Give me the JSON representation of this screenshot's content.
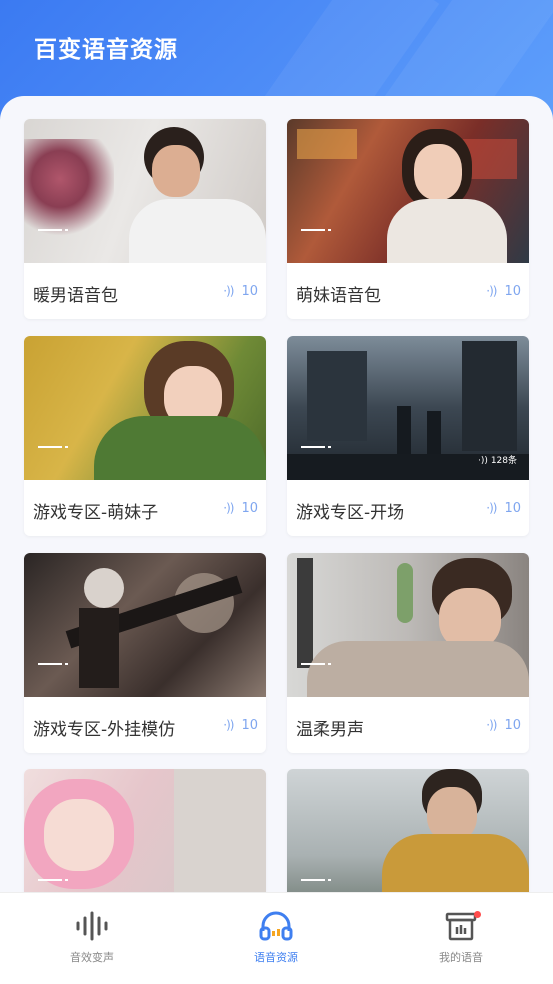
{
  "header": {
    "title": "百变语音资源"
  },
  "cards": [
    {
      "label": "暖男语音包",
      "count": "10"
    },
    {
      "label": "萌妹语音包",
      "count": "10"
    },
    {
      "label": "游戏专区-萌妹子",
      "count": "10"
    },
    {
      "label": "游戏专区-开场",
      "count": "10",
      "badge": "128条"
    },
    {
      "label": "游戏专区-外挂模仿",
      "count": "10"
    },
    {
      "label": "温柔男声",
      "count": "10"
    },
    {
      "label": "",
      "count": ""
    },
    {
      "label": "",
      "count": ""
    }
  ],
  "tabs": [
    {
      "label": "音效变声",
      "icon": "waveform-icon",
      "active": false
    },
    {
      "label": "语音资源",
      "icon": "headphones-icon",
      "active": true
    },
    {
      "label": "我的语音",
      "icon": "my-voice-icon",
      "active": false,
      "dot": true
    }
  ],
  "colors": {
    "accent": "#3f7ff0",
    "header_start": "#3b7af2",
    "header_end": "#5fa0fb",
    "dot": "#ff4b4b"
  }
}
